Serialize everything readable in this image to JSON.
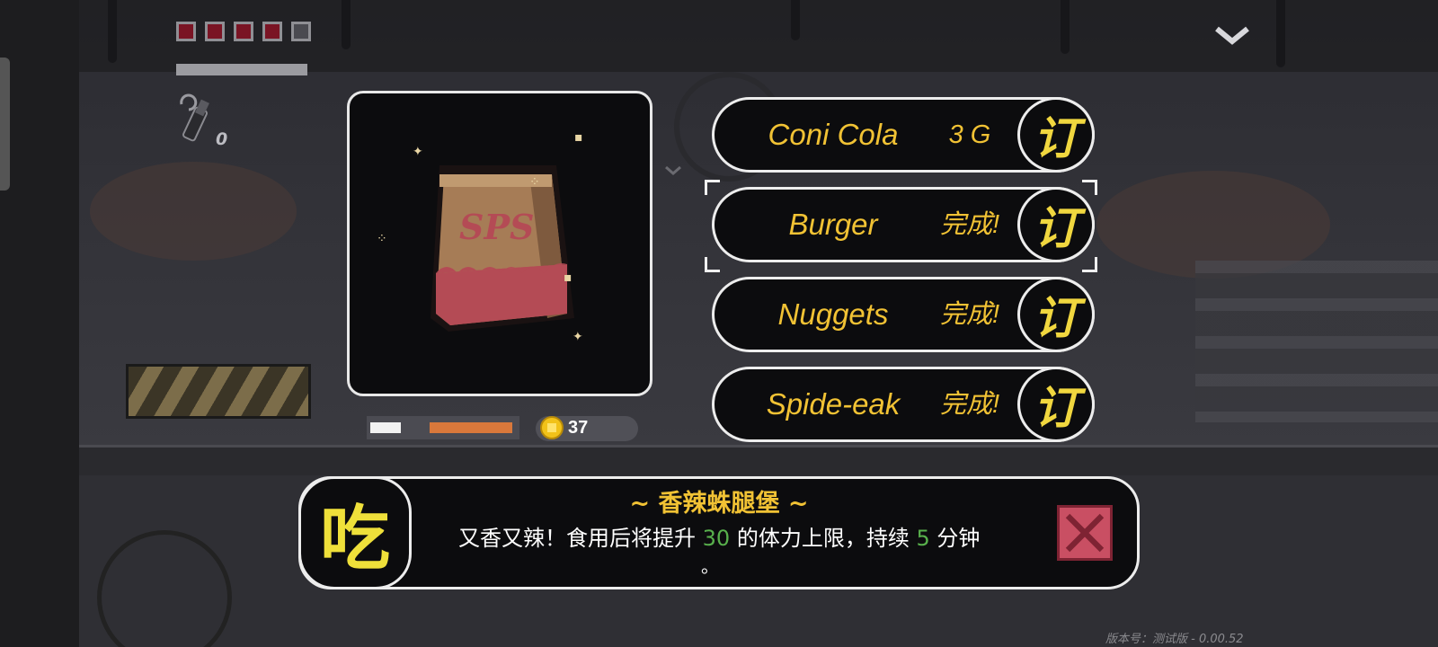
{
  "hud": {
    "health": {
      "filled": 4,
      "total": 5,
      "fill_color": "#7a1424",
      "empty_color": "#4a4a50"
    },
    "stamina_fraction": 1.0,
    "weapon_icon": "gun-icon",
    "ammo": "0"
  },
  "preview": {
    "item_image": "sps-paper-bag",
    "bag_logo": "SPS"
  },
  "status": {
    "coins": "37",
    "coin_icon": "coin-icon"
  },
  "orders": [
    {
      "name": "Coni Cola",
      "status": "3 G",
      "button": "订",
      "selected": false
    },
    {
      "name": "Burger",
      "status": "完成!",
      "button": "订",
      "selected": true
    },
    {
      "name": "Nuggets",
      "status": "完成!",
      "button": "订",
      "selected": false
    },
    {
      "name": "Spide-eak",
      "status": "完成!",
      "button": "订",
      "selected": false
    }
  ],
  "description": {
    "eat_button": "吃",
    "title": "~ 香辣蛛腿堡 ~",
    "line_part1": "又香又辣！食用后将提升 ",
    "value1": "30",
    "line_part2": " 的体力上限，持续 ",
    "value2": "5",
    "line_part3": " 分钟",
    "line_end": "。"
  },
  "colors": {
    "accent_yellow": "#f1c234",
    "highlight_green": "#58b04c",
    "close_red": "#c94f63"
  },
  "version": "版本号：测试版 - 0.00.52"
}
